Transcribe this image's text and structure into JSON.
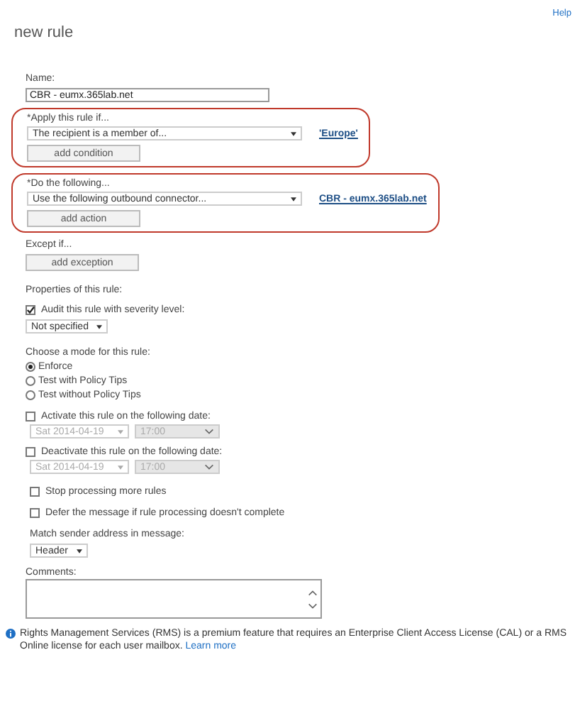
{
  "page": {
    "title": "new rule",
    "help": "Help"
  },
  "name": {
    "label": "Name:",
    "value": "CBR - eumx.365lab.net"
  },
  "rule_groups": [
    {
      "label": "*Apply this rule if...",
      "dropdown": "The recipient is a member of...",
      "link": "'Europe'",
      "button": "add condition",
      "highlighted": true
    },
    {
      "label": "*Do the following...",
      "dropdown": "Use the following outbound connector...",
      "link": "CBR - eumx.365lab.net",
      "button": "add action",
      "highlighted": true
    }
  ],
  "exception": {
    "label": "Except if...",
    "button": "add exception"
  },
  "properties_label": "Properties of this rule:",
  "audit": {
    "label": "Audit this rule with severity level:",
    "checked": true,
    "dropdown": "Not specified"
  },
  "mode": {
    "label": "Choose a mode for this rule:",
    "options": [
      {
        "label": "Enforce",
        "selected": true
      },
      {
        "label": "Test with Policy Tips",
        "selected": false
      },
      {
        "label": "Test without Policy Tips",
        "selected": false
      }
    ]
  },
  "schedule": [
    {
      "label": "Activate this rule on the following date:",
      "checked": false,
      "date": "Sat 2014-04-19",
      "time": "17:00",
      "disabled": true
    },
    {
      "label": "Deactivate this rule on the following date:",
      "checked": false,
      "date": "Sat 2014-04-19",
      "time": "17:00",
      "disabled": true
    }
  ],
  "options": [
    {
      "label": "Stop processing more rules",
      "checked": false
    },
    {
      "label": "Defer the message if rule processing doesn't complete",
      "checked": false
    }
  ],
  "match": {
    "label": "Match sender address in message:",
    "dropdown": "Header"
  },
  "comments": {
    "label": "Comments:"
  },
  "notice": {
    "text": "Rights Management Services (RMS) is a premium feature that requires an Enterprise Client Access License (CAL) or a RMS Online license for each user mailbox.",
    "link": "Learn more"
  }
}
